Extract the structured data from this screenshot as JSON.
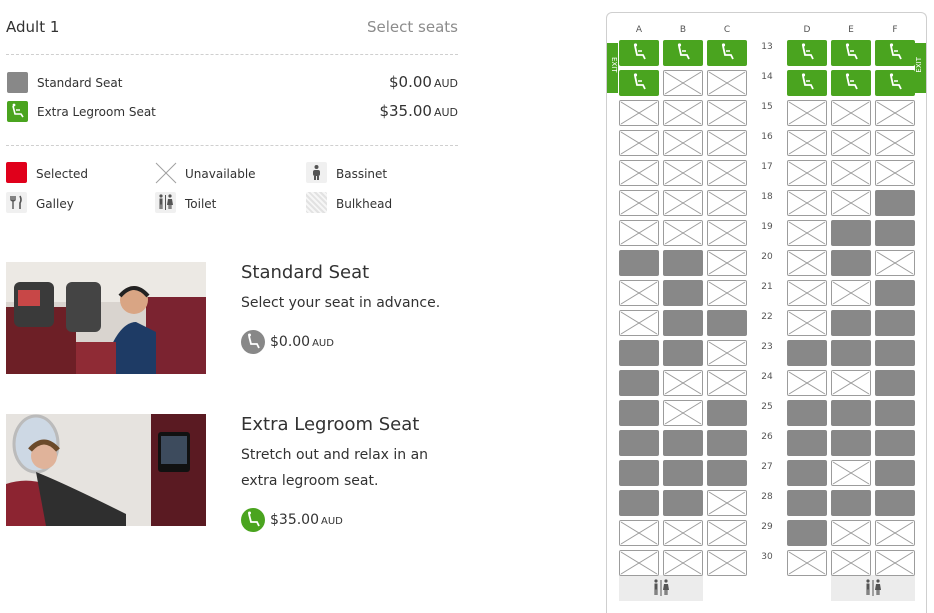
{
  "header": {
    "passenger": "Adult 1",
    "action": "Select seats"
  },
  "prices": [
    {
      "label": "Standard Seat",
      "amount": "$0.00",
      "currency": "AUD",
      "swatch": "#888888"
    },
    {
      "label": "Extra Legroom Seat",
      "amount": "$35.00",
      "currency": "AUD",
      "swatch": "#4aa41f"
    }
  ],
  "legend": {
    "selected": "Selected",
    "unavailable": "Unavailable",
    "bassinet": "Bassinet",
    "galley": "Galley",
    "toilet": "Toilet",
    "bulkhead": "Bulkhead"
  },
  "cards": [
    {
      "title": "Standard Seat",
      "description": "Select your seat in advance.",
      "amount": "$0.00",
      "currency": "AUD",
      "badge_color": "#888888"
    },
    {
      "title": "Extra Legroom Seat",
      "description": "Stretch out and relax in an extra legroom seat.",
      "amount": "$35.00",
      "currency": "AUD",
      "badge_color": "#4aa41f"
    }
  ],
  "colors": {
    "selected": "#e0001b",
    "standard": "#888888",
    "extra_legroom": "#4aa41f",
    "unavailable_border": "#9c9c9c"
  },
  "seatmap": {
    "columns": [
      "A",
      "B",
      "C",
      "D",
      "E",
      "F"
    ],
    "exit_label": "EXIT",
    "rows": [
      {
        "num": "13",
        "seats": [
          "xl",
          "xl",
          "xl",
          "xl",
          "xl",
          "xl"
        ]
      },
      {
        "num": "14",
        "seats": [
          "xl",
          "na",
          "na",
          "xl",
          "xl",
          "xl"
        ]
      },
      {
        "num": "15",
        "seats": [
          "na",
          "na",
          "na",
          "na",
          "na",
          "na"
        ]
      },
      {
        "num": "16",
        "seats": [
          "na",
          "na",
          "na",
          "na",
          "na",
          "na"
        ]
      },
      {
        "num": "17",
        "seats": [
          "na",
          "na",
          "na",
          "na",
          "na",
          "na"
        ]
      },
      {
        "num": "18",
        "seats": [
          "na",
          "na",
          "na",
          "na",
          "na",
          "std"
        ]
      },
      {
        "num": "19",
        "seats": [
          "na",
          "na",
          "na",
          "na",
          "std",
          "std"
        ]
      },
      {
        "num": "20",
        "seats": [
          "std",
          "std",
          "na",
          "na",
          "std",
          "na"
        ]
      },
      {
        "num": "21",
        "seats": [
          "na",
          "std",
          "na",
          "na",
          "na",
          "std"
        ]
      },
      {
        "num": "22",
        "seats": [
          "na",
          "std",
          "std",
          "na",
          "std",
          "std"
        ]
      },
      {
        "num": "23",
        "seats": [
          "std",
          "std",
          "na",
          "std",
          "std",
          "std"
        ]
      },
      {
        "num": "24",
        "seats": [
          "std",
          "na",
          "na",
          "na",
          "na",
          "std"
        ]
      },
      {
        "num": "25",
        "seats": [
          "std",
          "na",
          "std",
          "std",
          "std",
          "std"
        ]
      },
      {
        "num": "26",
        "seats": [
          "std",
          "std",
          "std",
          "std",
          "std",
          "std"
        ]
      },
      {
        "num": "27",
        "seats": [
          "std",
          "std",
          "std",
          "std",
          "na",
          "std"
        ]
      },
      {
        "num": "28",
        "seats": [
          "std",
          "std",
          "na",
          "std",
          "std",
          "std"
        ]
      },
      {
        "num": "29",
        "seats": [
          "na",
          "na",
          "na",
          "std",
          "na",
          "na"
        ]
      },
      {
        "num": "30",
        "seats": [
          "na",
          "na",
          "na",
          "na",
          "na",
          "na"
        ]
      }
    ]
  }
}
